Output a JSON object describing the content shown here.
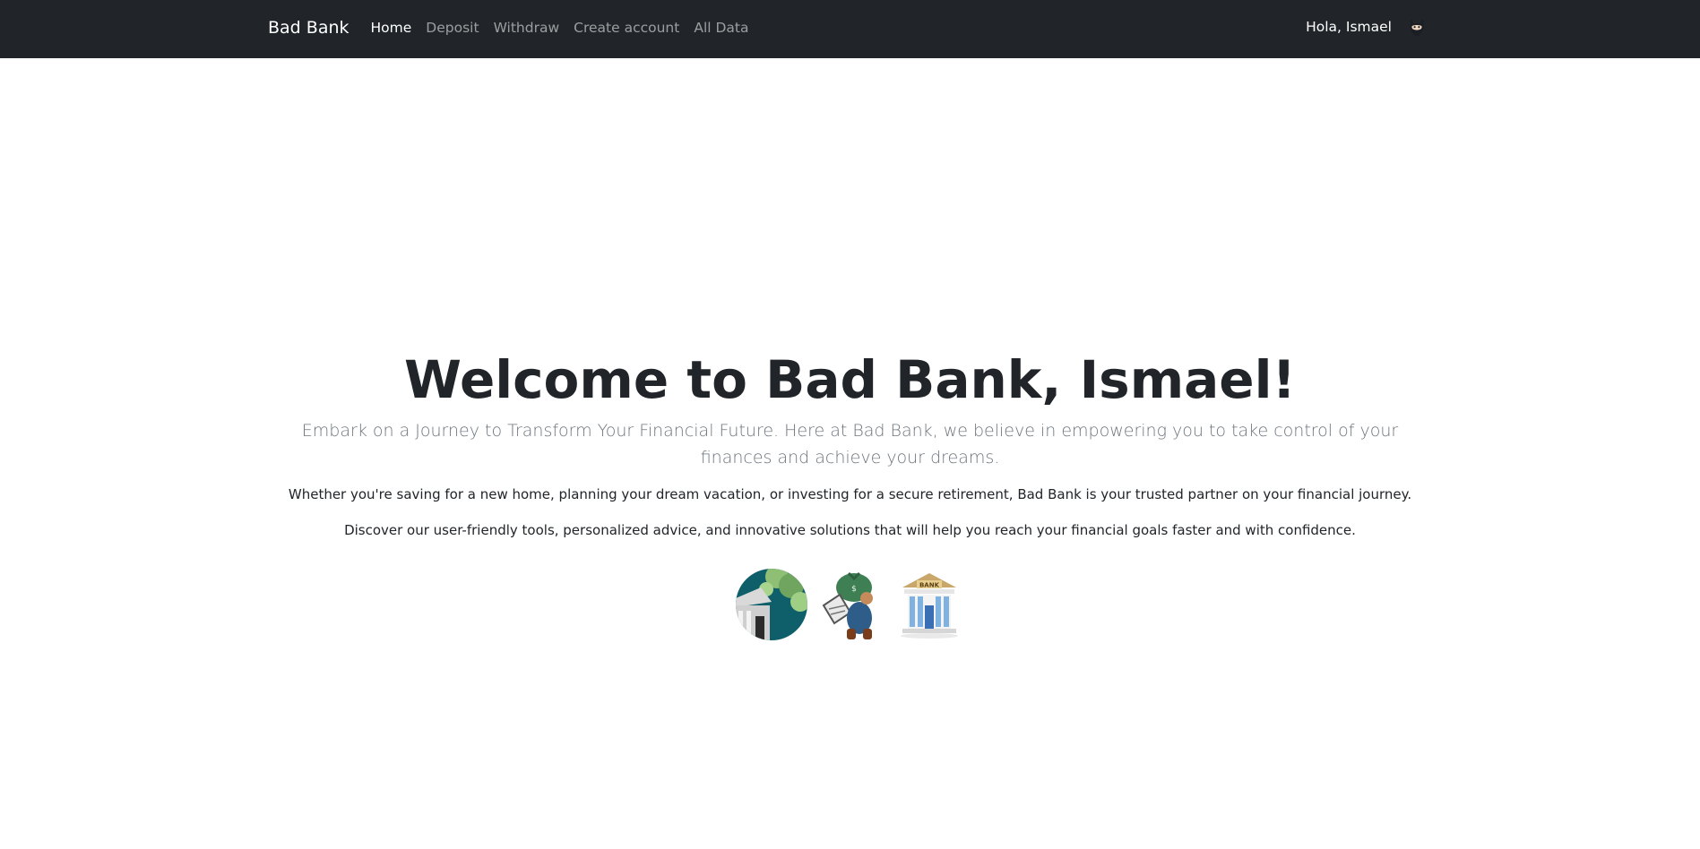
{
  "nav": {
    "brand": "Bad Bank",
    "links": [
      {
        "label": "Home",
        "active": true
      },
      {
        "label": "Deposit",
        "active": false
      },
      {
        "label": "Withdraw",
        "active": false
      },
      {
        "label": "Create account",
        "active": false
      },
      {
        "label": "All Data",
        "active": false
      }
    ],
    "greeting": "Hola, Ismael",
    "avatar_icon": "cat-avatar-icon"
  },
  "hero": {
    "title": "Welcome to Bad Bank, Ismael!",
    "lead": "Embark on a Journey to Transform Your Financial Future. Here at Bad Bank, we believe in empowering you to take control of your finances and achieve your dreams.",
    "text1": "Whether you're saving for a new home, planning your dream vacation, or investing for a secure retirement, Bad Bank is your trusted partner on your financial journey.",
    "text2": "Discover our user-friendly tools, personalized advice, and innovative solutions that will help you reach your financial goals faster and with confidence.",
    "images": [
      "bank-building-photo",
      "money-bag-robber-illustration",
      "bank-building-icon"
    ],
    "bank_sign": "BANK"
  },
  "colors": {
    "navbar_bg": "#212529",
    "nav_active": "#ffffff",
    "nav_inactive": "rgba(255,255,255,0.55)",
    "lead_text": "#6c757d",
    "body_text": "#212529"
  }
}
